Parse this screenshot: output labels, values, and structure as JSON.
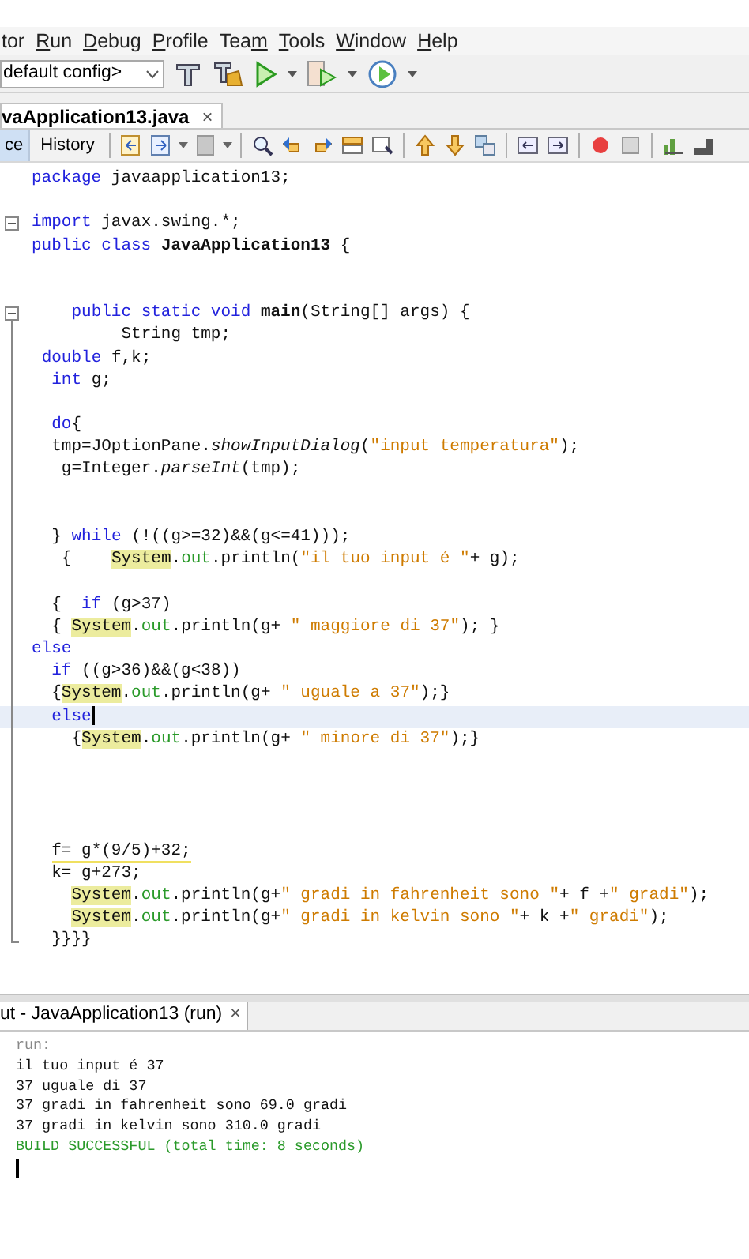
{
  "menu": [
    {
      "parts": [
        {
          "text": "tor",
          "underlined": false
        }
      ]
    },
    {
      "parts": [
        {
          "text": "R",
          "underlined": true
        },
        {
          "text": "un",
          "underlined": false
        }
      ]
    },
    {
      "parts": [
        {
          "text": "D",
          "underlined": true
        },
        {
          "text": "ebug",
          "underlined": false
        }
      ]
    },
    {
      "parts": [
        {
          "text": "P",
          "underlined": true
        },
        {
          "text": "rofile",
          "underlined": false
        }
      ]
    },
    {
      "parts": [
        {
          "text": "Tea",
          "underlined": false
        },
        {
          "text": "m",
          "underlined": true
        }
      ]
    },
    {
      "parts": [
        {
          "text": "T",
          "underlined": true
        },
        {
          "text": "ools",
          "underlined": false
        }
      ]
    },
    {
      "parts": [
        {
          "text": "W",
          "underlined": true
        },
        {
          "text": "indow",
          "underlined": false
        }
      ]
    },
    {
      "parts": [
        {
          "text": "H",
          "underlined": true
        },
        {
          "text": "elp",
          "underlined": false
        }
      ]
    }
  ],
  "config": {
    "value": "default config>"
  },
  "editor_tab": {
    "title": "vaApplication13.java",
    "close": "×"
  },
  "view_tabs": [
    {
      "label": "ce",
      "selected": true
    },
    {
      "label": "History",
      "selected": false
    }
  ],
  "code_lines": [
    {
      "kind": "plain",
      "segments": [
        {
          "kind": "kw",
          "text": "package"
        },
        {
          "kind": "plain",
          "text": " javaapplication13;"
        }
      ]
    },
    {
      "kind": "plain"
    },
    {
      "kind": "fold",
      "segments": [
        {
          "kind": "kw",
          "text": "import"
        },
        {
          "kind": "plain",
          "text": " javax.swing.*;"
        }
      ]
    },
    {
      "kind": "plain",
      "segments": [
        {
          "kind": "kw",
          "text": "public class"
        },
        {
          "kind": "bold",
          "text": " JavaApplication13"
        },
        {
          "kind": "plain",
          "text": " {"
        }
      ]
    },
    {
      "kind": "plain"
    },
    {
      "kind": "plain"
    },
    {
      "kind": "fold",
      "segments": [
        {
          "kind": "kw",
          "text": "    public static void"
        },
        {
          "kind": "bold",
          "text": " main"
        },
        {
          "kind": "plain",
          "text": "(String[] args) {"
        }
      ]
    },
    {
      "kind": "plain",
      "segments": [
        {
          "kind": "plain",
          "text": "         String tmp;"
        }
      ]
    },
    {
      "kind": "plain",
      "segments": [
        {
          "kind": "kw",
          "text": " double"
        },
        {
          "kind": "plain",
          "text": " f,k;"
        }
      ]
    },
    {
      "kind": "plain",
      "segments": [
        {
          "kind": "kw",
          "text": "  int"
        },
        {
          "kind": "plain",
          "text": " g;"
        }
      ]
    },
    {
      "kind": "plain"
    },
    {
      "kind": "plain",
      "segments": [
        {
          "kind": "kw",
          "text": "  do"
        },
        {
          "kind": "plain",
          "text": "{"
        }
      ]
    },
    {
      "kind": "plain",
      "segments": [
        {
          "kind": "plain",
          "text": "  tmp=JOptionPane."
        },
        {
          "kind": "italic",
          "text": "showInputDialog"
        },
        {
          "kind": "plain",
          "text": "("
        },
        {
          "kind": "str",
          "text": "\"input temperatura\""
        },
        {
          "kind": "plain",
          "text": ");"
        }
      ]
    },
    {
      "kind": "plain",
      "segments": [
        {
          "kind": "plain",
          "text": "   g=Integer."
        },
        {
          "kind": "italic",
          "text": "parseInt"
        },
        {
          "kind": "plain",
          "text": "(tmp);"
        }
      ]
    },
    {
      "kind": "plain"
    },
    {
      "kind": "plain"
    },
    {
      "kind": "plain",
      "segments": [
        {
          "kind": "plain",
          "text": "  }"
        },
        {
          "kind": "kw",
          "text": " while"
        },
        {
          "kind": "plain",
          "text": " (!((g>=32)&&(g<=41)));"
        }
      ]
    },
    {
      "kind": "plain",
      "segments": [
        {
          "kind": "plain",
          "text": "   {"
        },
        {
          "kind": "mark",
          "text": "    System"
        },
        {
          "kind": "plain",
          "text": "."
        },
        {
          "kind": "field",
          "text": "out"
        },
        {
          "kind": "plain",
          "text": ".println("
        },
        {
          "kind": "str",
          "text": "\"il tuo input é \""
        },
        {
          "kind": "plain",
          "text": "+ g);"
        }
      ]
    },
    {
      "kind": "plain"
    },
    {
      "kind": "plain",
      "segments": [
        {
          "kind": "plain",
          "text": "  {"
        },
        {
          "kind": "kw",
          "text": "  if"
        },
        {
          "kind": "plain",
          "text": " (g>37)"
        }
      ]
    },
    {
      "kind": "plain",
      "segments": [
        {
          "kind": "plain",
          "text": "  {"
        },
        {
          "kind": "mark",
          "text": " System"
        },
        {
          "kind": "plain",
          "text": "."
        },
        {
          "kind": "field",
          "text": "out"
        },
        {
          "kind": "plain",
          "text": ".println(g+"
        },
        {
          "kind": "str",
          "text": " \" maggiore di 37\""
        },
        {
          "kind": "plain",
          "text": "); }"
        }
      ]
    },
    {
      "kind": "plain",
      "segments": [
        {
          "kind": "kw",
          "text": "else"
        }
      ]
    },
    {
      "kind": "plain",
      "segments": [
        {
          "kind": "kw",
          "text": "  if"
        },
        {
          "kind": "plain",
          "text": " ((g>36)&&(g<38))"
        }
      ]
    },
    {
      "kind": "plain",
      "segments": [
        {
          "kind": "plain",
          "text": "  {"
        },
        {
          "kind": "mark",
          "text": "System"
        },
        {
          "kind": "plain",
          "text": "."
        },
        {
          "kind": "field",
          "text": "out"
        },
        {
          "kind": "plain",
          "text": ".println(g+"
        },
        {
          "kind": "str",
          "text": " \" uguale a 37\""
        },
        {
          "kind": "plain",
          "text": ");}"
        }
      ]
    },
    {
      "kind": "current",
      "segments": [
        {
          "kind": "kw",
          "text": "  else"
        }
      ]
    },
    {
      "kind": "plain",
      "segments": [
        {
          "kind": "plain",
          "text": "    {"
        },
        {
          "kind": "mark",
          "text": "System"
        },
        {
          "kind": "plain",
          "text": "."
        },
        {
          "kind": "field",
          "text": "out"
        },
        {
          "kind": "plain",
          "text": ".println(g+"
        },
        {
          "kind": "str",
          "text": " \" minore di 37\""
        },
        {
          "kind": "plain",
          "text": ");}"
        }
      ]
    },
    {
      "kind": "plain"
    },
    {
      "kind": "plain"
    },
    {
      "kind": "plain"
    },
    {
      "kind": "plain"
    },
    {
      "kind": "plain",
      "segments": [
        {
          "kind": "warning",
          "text": "  f= g*(9/5)+32;"
        }
      ]
    },
    {
      "kind": "plain",
      "segments": [
        {
          "kind": "plain",
          "text": "  k= g+273;"
        }
      ]
    },
    {
      "kind": "plain",
      "segments": [
        {
          "kind": "mark",
          "text": "    System"
        },
        {
          "kind": "plain",
          "text": "."
        },
        {
          "kind": "field",
          "text": "out"
        },
        {
          "kind": "plain",
          "text": ".println(g+"
        },
        {
          "kind": "str",
          "text": "\" gradi in fahrenheit sono \""
        },
        {
          "kind": "plain",
          "text": "+ f +"
        },
        {
          "kind": "str",
          "text": "\" gradi\""
        },
        {
          "kind": "plain",
          "text": ");"
        }
      ]
    },
    {
      "kind": "plain",
      "segments": [
        {
          "kind": "mark",
          "text": "    System"
        },
        {
          "kind": "plain",
          "text": "."
        },
        {
          "kind": "field",
          "text": "out"
        },
        {
          "kind": "plain",
          "text": ".println(g+"
        },
        {
          "kind": "str",
          "text": "\" gradi in kelvin sono \""
        },
        {
          "kind": "plain",
          "text": "+ k +"
        },
        {
          "kind": "str",
          "text": "\" gradi\""
        },
        {
          "kind": "plain",
          "text": ");"
        }
      ]
    },
    {
      "kind": "fold-end",
      "segments": [
        {
          "kind": "plain",
          "text": "  }}}}"
        }
      ]
    }
  ],
  "output_tab": {
    "title": "ut - JavaApplication13 (run)",
    "close": "×"
  },
  "output_lines": [
    {
      "kind": "meta",
      "text": "run:"
    },
    {
      "kind": "plain",
      "text": "il tuo input é 37"
    },
    {
      "kind": "plain",
      "text": "37 uguale di 37"
    },
    {
      "kind": "plain",
      "text": "37 gradi in fahrenheit sono 69.0 gradi"
    },
    {
      "kind": "plain",
      "text": "37 gradi in kelvin sono 310.0 gradi"
    },
    {
      "kind": "success",
      "text": "BUILD SUCCESSFUL (total time: 8 seconds)"
    }
  ],
  "output_cursor": true
}
